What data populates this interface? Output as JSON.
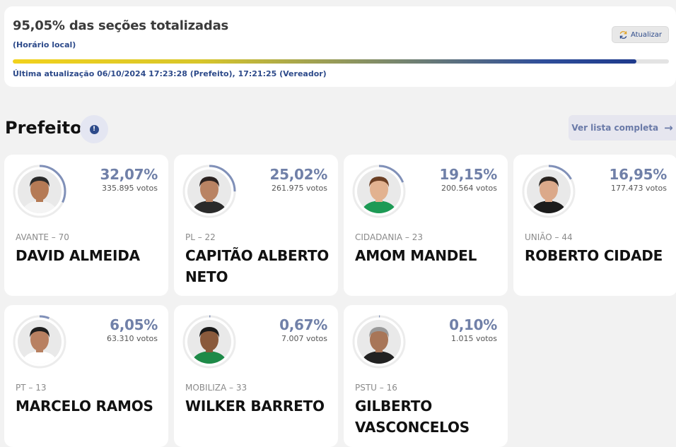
{
  "status": {
    "title": "95,05% das seções totalizadas",
    "subtitle": "(Horário local)",
    "refresh_label": "Atualizar",
    "progress": 0.95,
    "updated": "Última atualização 06/10/2024 17:23:28 (Prefeito), 17:21:25 (Vereador)"
  },
  "section": {
    "title": "Prefeito",
    "info_icon_text": "!",
    "list_button": "Ver lista completa",
    "list_arrow": "→"
  },
  "candidates": [
    {
      "percent": "32,07%",
      "votes": "335.895 votos",
      "party": "AVANTE – 70",
      "name": "DAVID ALMEIDA",
      "share": 0.3207,
      "skin": "#b57a55",
      "hair": "#2a2a2a",
      "shirt": "#f4f4f4"
    },
    {
      "percent": "25,02%",
      "votes": "261.975 votos",
      "party": "PL – 22",
      "name": "CAPITÃO ALBERTO NETO",
      "share": 0.2502,
      "skin": "#b98363",
      "hair": "#2b2220",
      "shirt": "#2a2a2a"
    },
    {
      "percent": "19,15%",
      "votes": "200.564 votos",
      "party": "CIDADANIA – 23",
      "name": "AMOM MANDEL",
      "share": 0.1915,
      "skin": "#e2b290",
      "hair": "#6b3f24",
      "shirt": "#1d9a55"
    },
    {
      "percent": "16,95%",
      "votes": "177.473 votos",
      "party": "UNIÃO – 44",
      "name": "ROBERTO CIDADE",
      "share": 0.1695,
      "skin": "#dba98a",
      "hair": "#2a2420",
      "shirt": "#1c1c1c"
    },
    {
      "percent": "6,05%",
      "votes": "63.310 votos",
      "party": "PT – 13",
      "name": "MARCELO RAMOS",
      "share": 0.0605,
      "skin": "#b88061",
      "hair": "#1e1e1e",
      "shirt": "#ffffff"
    },
    {
      "percent": "0,67%",
      "votes": "7.007 votos",
      "party": "MOBILIZA – 33",
      "name": "WILKER BARRETO",
      "share": 0.0067,
      "skin": "#8a5a3c",
      "hair": "#1a1a1a",
      "shirt": "#1e8a48"
    },
    {
      "percent": "0,10%",
      "votes": "1.015 votos",
      "party": "PSTU – 16",
      "name": "GILBERTO VASCONCELOS",
      "share": 0.001,
      "skin": "#a87658",
      "hair": "#9a9a9a",
      "shirt": "#222222"
    }
  ],
  "colors": {
    "accent": "#2d4a8a",
    "percent": "#7080a8",
    "ring_track": "#ececec",
    "ring_arc": "#8090b8"
  }
}
